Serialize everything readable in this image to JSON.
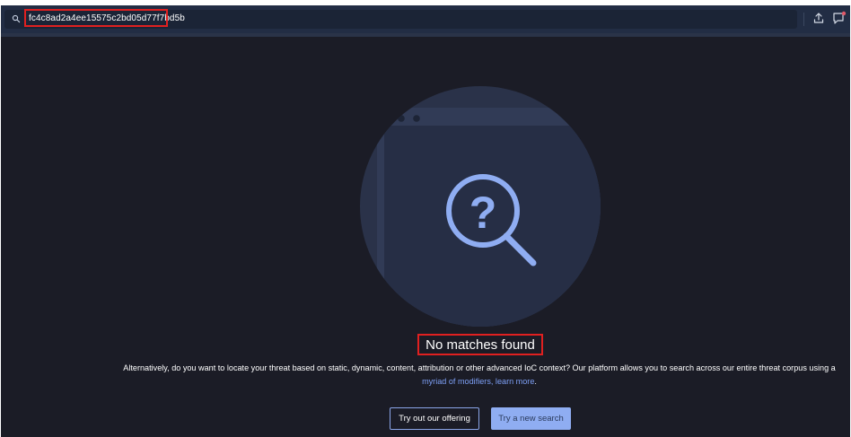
{
  "search": {
    "query": "fc4c8ad2a4ee15575c2bd05d77f7bd5b",
    "icon": "search-icon"
  },
  "toolbar": {
    "upload_icon": "upload-icon",
    "feedback_icon": "feedback-icon"
  },
  "empty_state": {
    "title": "No matches found",
    "description_text": "Alternatively, do you want to locate your threat based on static, dynamic, content, attribution or other advanced IoC context? Our platform allows you to search across our entire threat corpus using a ",
    "link_text": "myriad of modifiers, learn more",
    "description_end": "."
  },
  "buttons": {
    "offering_label": "Try out our offering",
    "new_search_label": "Try a new search"
  },
  "colors": {
    "background": "#1b1c26",
    "topbar": "#222d44",
    "accent": "#8fadf2",
    "link": "#7d9ff5",
    "highlight": "#e02020"
  }
}
